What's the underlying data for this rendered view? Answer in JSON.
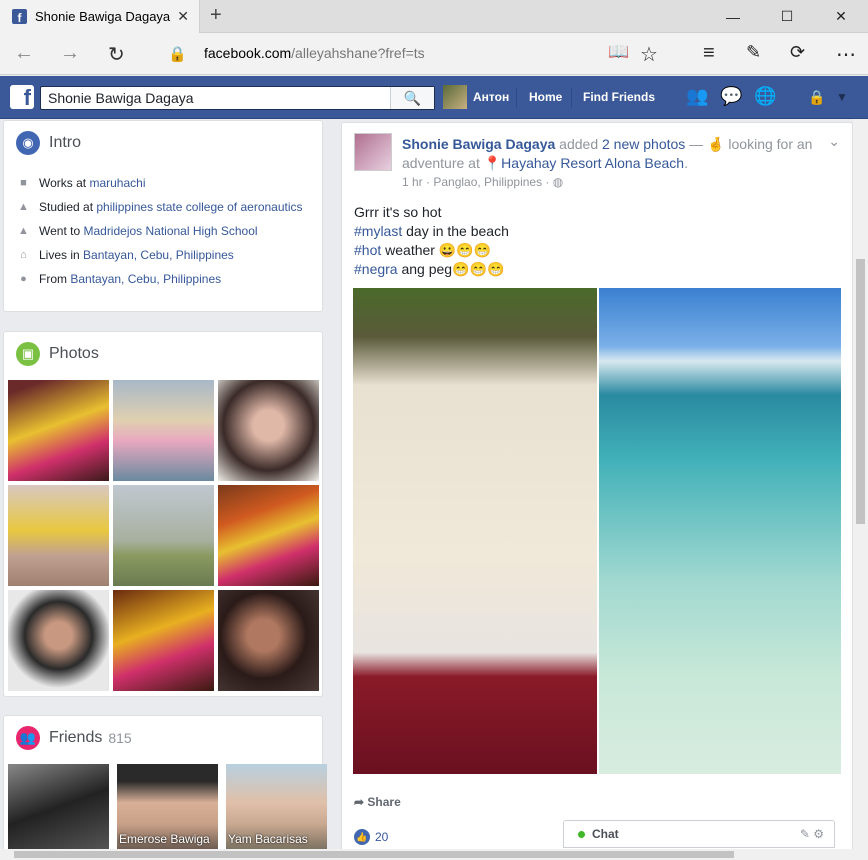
{
  "browser": {
    "tab_title": "Shonie Bawiga Dagaya",
    "tab_close": "✕",
    "new_tab": "+",
    "address_host": "facebook.com",
    "address_path": "/alleyahshane?fref=ts",
    "window_buttons": [
      "—",
      "☐",
      "✕"
    ]
  },
  "fb": {
    "logo": "f",
    "search_value": "Shonie Bawiga Dagaya",
    "user_name": "Антон",
    "nav": [
      "Home",
      "Find Friends"
    ]
  },
  "intro": {
    "title": "Intro",
    "rows": [
      {
        "pre": "Works at ",
        "link": "maruhachi",
        "icon": "briefcase-icon"
      },
      {
        "pre": "Studied at ",
        "link": "philippines state college of aeronautics",
        "icon": "school-icon"
      },
      {
        "pre": "Went to ",
        "link": "Madridejos National High School",
        "icon": "school-icon"
      },
      {
        "pre": "Lives in ",
        "link": "Bantayan, Cebu, Philippines",
        "icon": "home-icon"
      },
      {
        "pre": "From ",
        "link": "Bantayan, Cebu, Philippines",
        "icon": "location-pin-icon"
      }
    ]
  },
  "photos": {
    "title": "Photos"
  },
  "friends": {
    "title": "Friends",
    "count": "815",
    "items": [
      {
        "name": ""
      },
      {
        "name": "Emerose Bawiga"
      },
      {
        "name": "Yam Bacarisas"
      }
    ]
  },
  "post": {
    "author": "Shonie Bawiga Dagaya",
    "action_pre": " added ",
    "action_link": "2 new photos",
    "action_mid": " — ",
    "feeling": "looking for an adventure at ",
    "place": "Hayahay Resort Alona Beach",
    "place_suffix": ".",
    "meta": "1 hr · Panglao, Philippines ·",
    "line1": "Grrr it's so hot",
    "line2_tag": "#mylast",
    "line2_rest": " day in the beach",
    "line3_tag": "#hot",
    "line3_rest": " weather 😀😁😁",
    "line4_tag": "#negra",
    "line4_rest": " ang peg😁😁😁",
    "share": "Share",
    "likes": "20"
  },
  "chat": {
    "label": "Chat"
  },
  "colors": {
    "fb_blue": "#3b5998",
    "link": "#365899",
    "online": "#42b72a"
  }
}
